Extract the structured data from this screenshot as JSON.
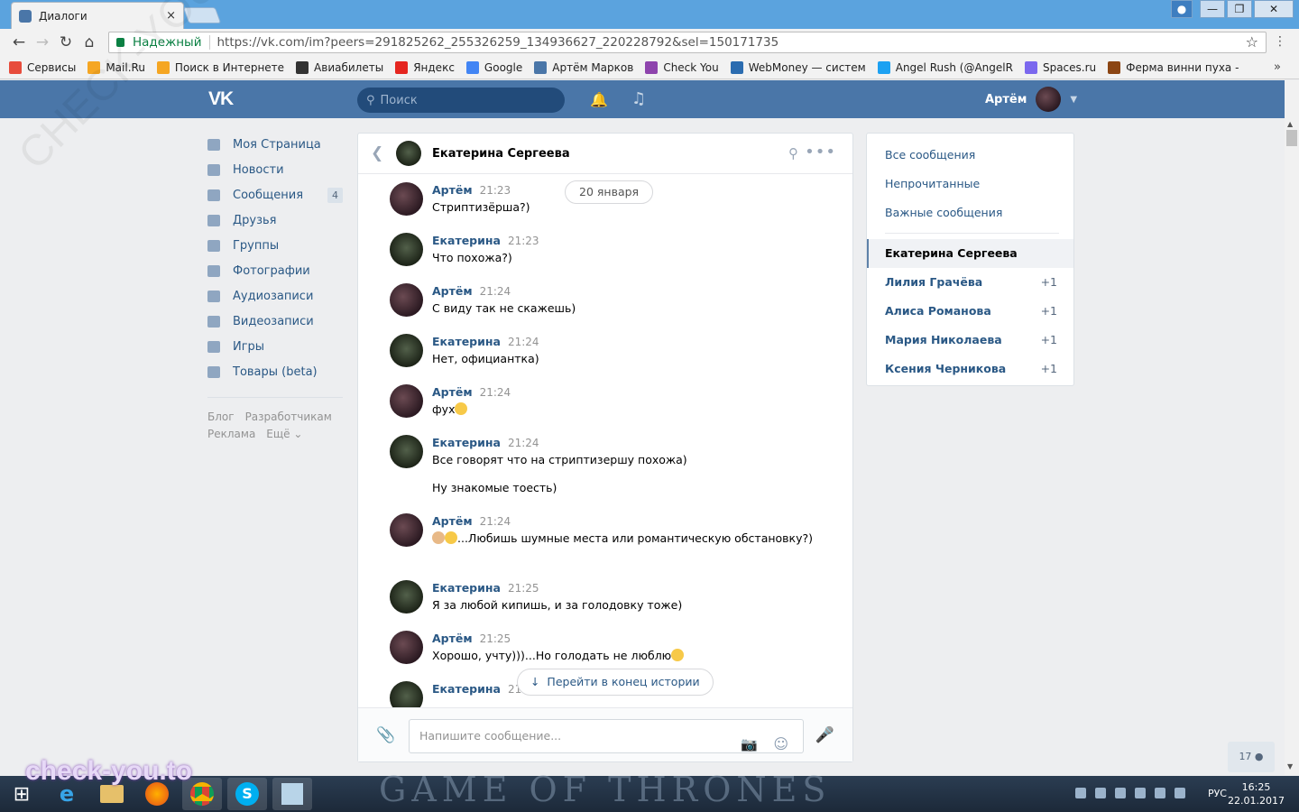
{
  "browser": {
    "tab_title": "Диалоги",
    "tab_close": "×",
    "security_label": "Надежный",
    "url": "https://vk.com/im?peers=291825262_255326259_134936627_220228792&sel=150171735",
    "bookmarks": [
      {
        "label": "Сервисы",
        "color": "#e74c3c"
      },
      {
        "label": "Mail.Ru",
        "color": "#f5a623"
      },
      {
        "label": "Поиск в Интернете",
        "color": "#f5a623"
      },
      {
        "label": "Авиабилеты",
        "color": "#333333"
      },
      {
        "label": "Яндекс",
        "color": "#e52620"
      },
      {
        "label": "Google",
        "color": "#4285f4"
      },
      {
        "label": "Артём Марков",
        "color": "#4a76a8"
      },
      {
        "label": "Check You",
        "color": "#8e44ad"
      },
      {
        "label": "WebMoney — систем",
        "color": "#2b6cb0"
      },
      {
        "label": "Angel Rush (@AngelR",
        "color": "#1da1f2"
      },
      {
        "label": "Spaces.ru",
        "color": "#7b68ee"
      },
      {
        "label": "Ферма винни пуха -",
        "color": "#8b4513"
      }
    ],
    "bookmarks_more": "»"
  },
  "vk": {
    "logo": "VK",
    "search_placeholder": "Поиск",
    "user_name": "Артём",
    "accent": "#4a76a8"
  },
  "leftnav": {
    "items": [
      {
        "label": "Моя Страница"
      },
      {
        "label": "Новости"
      },
      {
        "label": "Сообщения",
        "badge": "4"
      },
      {
        "label": "Друзья"
      },
      {
        "label": "Группы"
      },
      {
        "label": "Фотографии"
      },
      {
        "label": "Аудиозаписи"
      },
      {
        "label": "Видеозаписи"
      },
      {
        "label": "Игры"
      },
      {
        "label": "Товары (beta)"
      }
    ],
    "footer": [
      "Блог",
      "Разработчикам",
      "Реклама",
      "Ещё ⌄"
    ]
  },
  "dialog": {
    "title": "Екатерина Сергеева",
    "date": "20 января",
    "jump_label": "Перейти в конец истории",
    "compose_placeholder": "Напишите сообщение...",
    "messages": [
      {
        "author": "Артём",
        "time": "21:23",
        "text": "Стриптизёрша?)",
        "kind": "a"
      },
      {
        "author": "Екатерина",
        "time": "21:23",
        "text": "Что похожа?)",
        "kind": "k"
      },
      {
        "author": "Артём",
        "time": "21:24",
        "text": "С виду так не скажешь)",
        "kind": "a"
      },
      {
        "author": "Екатерина",
        "time": "21:24",
        "text": "Нет, официантка)",
        "kind": "k"
      },
      {
        "author": "Артём",
        "time": "21:24",
        "text": "фух",
        "kind": "a"
      },
      {
        "author": "Екатерина",
        "time": "21:24",
        "text": "Все говорят что на стриптизершу похожа)",
        "extra": "Ну знакомые тоесть)",
        "kind": "k"
      },
      {
        "author": "Артём",
        "time": "21:24",
        "text": "...Любишь шумные места или романтическую обстановку?)",
        "kind": "a"
      },
      {
        "author": "Екатерина",
        "time": "21:25",
        "text": "Я за любой кипишь, и за голодовку тоже)",
        "kind": "k"
      },
      {
        "author": "Артём",
        "time": "21:25",
        "text": "Хорошо, учту)))...Но голодать не люблю",
        "kind": "a"
      },
      {
        "author": "Екатерина",
        "time": "21:25",
        "text": "",
        "kind": "k"
      }
    ]
  },
  "right": {
    "links": [
      "Все сообщения",
      "Непрочитанные",
      "Важные сообщения"
    ],
    "convos": [
      {
        "name": "Екатерина Сергеева",
        "count": ""
      },
      {
        "name": "Лилия Грачёва",
        "count": "+1"
      },
      {
        "name": "Алиса Романова",
        "count": "+1"
      },
      {
        "name": "Мария Николаева",
        "count": "+1"
      },
      {
        "name": "Ксения Черникова",
        "count": "+1"
      }
    ]
  },
  "online_count": "17",
  "taskbar": {
    "lang": "РУС",
    "time": "16:25",
    "date": "22.01.2017",
    "wallpaper_text": "GAME OF THRONES"
  },
  "watermark": "check-you.to",
  "watermark_diag": "CHECK-YOU.ME"
}
